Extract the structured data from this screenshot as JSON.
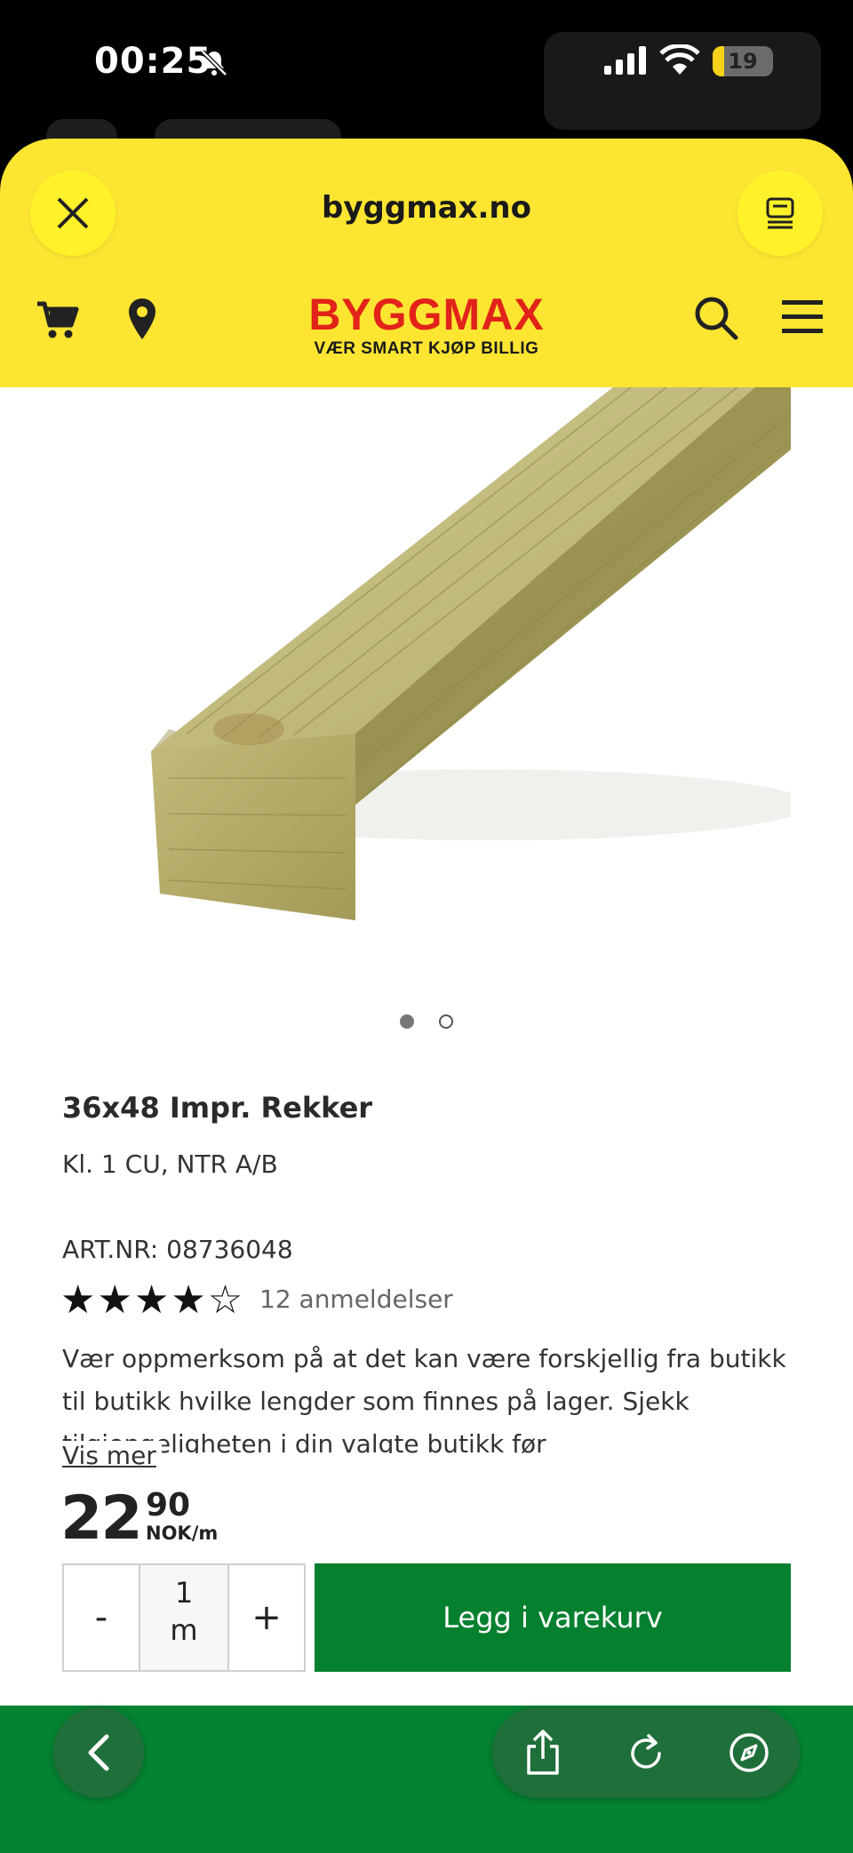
{
  "status_bar": {
    "time": "00:25",
    "battery": "19",
    "battery_level": 0.19,
    "silent_icon": "bell-slash-icon",
    "signal_icon": "cellular-signal-icon",
    "wifi_icon": "wifi-icon"
  },
  "browser": {
    "url": "byggmax.no",
    "close_icon": "close-icon",
    "reader_icon": "reader-icon"
  },
  "site_header": {
    "logo": "BYGGMAX",
    "tagline": "VÆR SMART KJØP BILLIG",
    "brand_color": "#e2231a",
    "background_color": "#fde532",
    "icons": [
      "cart-icon",
      "location-pin-icon",
      "search-icon",
      "menu-icon"
    ]
  },
  "gallery": {
    "image": "pressure-treated-timber-beam",
    "current_slide": 1,
    "total_slides": 2
  },
  "product": {
    "title": "36x48 Impr. Rekker",
    "subtitle": "Kl. 1 CU, NTR A/B",
    "art_nr": "ART.NR: 08736048",
    "rating": 4,
    "rating_max": 5,
    "stars": "★★★★☆",
    "reviews": "12 anmeldelser",
    "description": "Vær oppmerksom på at det kan være forskjellig fra butikk til butikk hvilke lengder som finnes på lager. Sjekk tilgjengeligheten i din valgte butikk før",
    "show_more": "Vis mer",
    "price_int": "22",
    "price_dec": "90",
    "price_unit": "NOK/m"
  },
  "cart_controls": {
    "minus": "-",
    "quantity": "1",
    "unit": "m",
    "plus": "+",
    "add_to_cart": "Legg i varekurv",
    "button_color": "#04802f"
  },
  "toolbar": {
    "color": "#048332",
    "icons": [
      "back-icon",
      "share-icon",
      "reload-icon",
      "compass-icon"
    ]
  }
}
